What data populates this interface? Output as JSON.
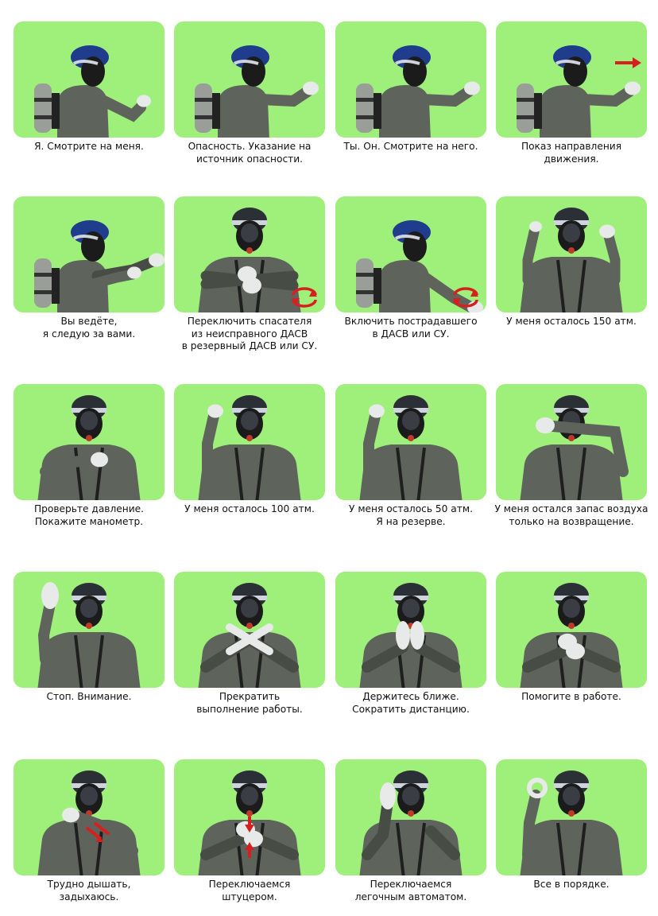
{
  "page": {
    "background": "#ffffff",
    "tile_color": "#9ef07a"
  },
  "signals": [
    {
      "caption": "Я. Смотрите на меня.",
      "pose": "side-self",
      "icon": ""
    },
    {
      "caption": "Опасность. Указание на\nисточник опасности.",
      "pose": "side-point",
      "icon": ""
    },
    {
      "caption": "Ты. Он. Смотрите на него.",
      "pose": "side-point",
      "icon": ""
    },
    {
      "caption": "Показ направления\nдвижения.",
      "pose": "side-point",
      "icon": "direction-arrow-icon"
    },
    {
      "caption": "Вы ведёте,\nя следую за вами.",
      "pose": "side-point-both",
      "icon": ""
    },
    {
      "caption": "Переключить спасателя\nиз неисправного ДАСВ\nв резервный ДАСВ или СУ.",
      "pose": "front-cross-horizontal",
      "icon": "rotate-arrows-icon"
    },
    {
      "caption": "Включить пострадавшего\nв ДАСВ или СУ.",
      "pose": "side-low",
      "icon": "rotate-arrows-icon"
    },
    {
      "caption": "У меня осталось 150 атм.",
      "pose": "front-both-up",
      "icon": ""
    },
    {
      "caption": "Проверьте давление.\nПокажите манометр.",
      "pose": "front-chest",
      "icon": ""
    },
    {
      "caption": "У меня осталось 100 атм.",
      "pose": "front-right-up",
      "icon": ""
    },
    {
      "caption": "У меня осталось 50 атм.\nЯ на резерве.",
      "pose": "front-right-up",
      "icon": ""
    },
    {
      "caption": "У меня остался запас воздуха\nтолько на возвращение.",
      "pose": "front-arm-over-face",
      "icon": ""
    },
    {
      "caption": "Стоп. Внимание.",
      "pose": "front-palm-up",
      "icon": ""
    },
    {
      "caption": "Прекратить\nвыполнение работы.",
      "pose": "front-cross",
      "icon": ""
    },
    {
      "caption": "Держитесь ближе.\nСократить дистанцию.",
      "pose": "front-hands-together",
      "icon": ""
    },
    {
      "caption": "Помогите в работе.",
      "pose": "front-fists",
      "icon": ""
    },
    {
      "caption": "Трудно дышать,\nзадыхаюсь.",
      "pose": "front-arm-neck",
      "icon": "red-arrows-icon"
    },
    {
      "caption": "Переключаемся\nштуцером.",
      "pose": "front-fists",
      "icon": "vertical-arrows-icon"
    },
    {
      "caption": "Переключаемся\nлегочным автоматом.",
      "pose": "front-palms-up",
      "icon": ""
    },
    {
      "caption": "Все в порядке.",
      "pose": "front-ok",
      "icon": ""
    }
  ]
}
